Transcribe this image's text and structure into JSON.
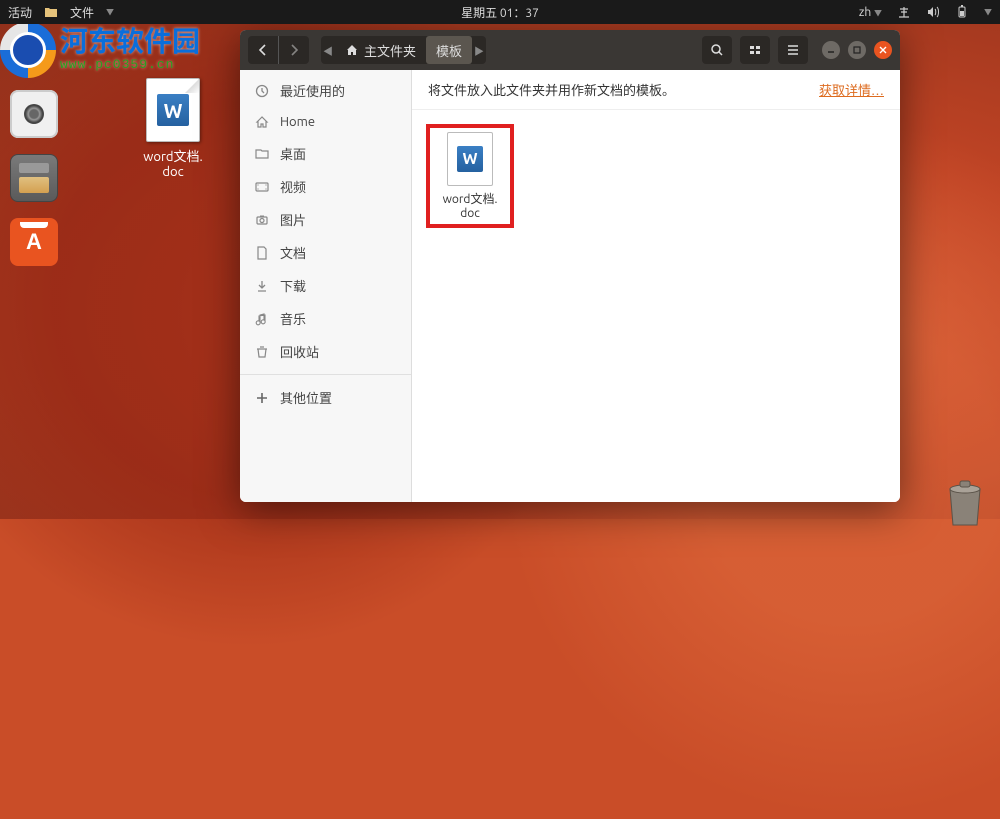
{
  "topbar": {
    "activities": "活动",
    "app_menu": "文件",
    "datetime": "星期五 01：37",
    "input": "zh"
  },
  "watermark": {
    "name": "河东软件园",
    "url": "www.pc0359.cn"
  },
  "desktop_file": {
    "label": "word文档.\ndoc"
  },
  "window": {
    "breadcrumb": {
      "home": "主文件夹",
      "current": "模板"
    },
    "info_text": "将文件放入此文件夹并用作新文档的模板。",
    "info_link": "获取详情…",
    "sidebar": [
      {
        "icon": "clock-icon",
        "label": "最近使用的"
      },
      {
        "icon": "home-icon",
        "label": "Home"
      },
      {
        "icon": "desktop-icon",
        "label": "桌面"
      },
      {
        "icon": "video-icon",
        "label": "视频"
      },
      {
        "icon": "photo-icon",
        "label": "图片"
      },
      {
        "icon": "doc-icon",
        "label": "文档"
      },
      {
        "icon": "download-icon",
        "label": "下载"
      },
      {
        "icon": "music-icon",
        "label": "音乐"
      },
      {
        "icon": "trash-icon",
        "label": "回收站"
      }
    ],
    "sidebar_other": "其他位置",
    "files": [
      {
        "label": "word文档.\ndoc",
        "highlighted": true
      }
    ]
  }
}
